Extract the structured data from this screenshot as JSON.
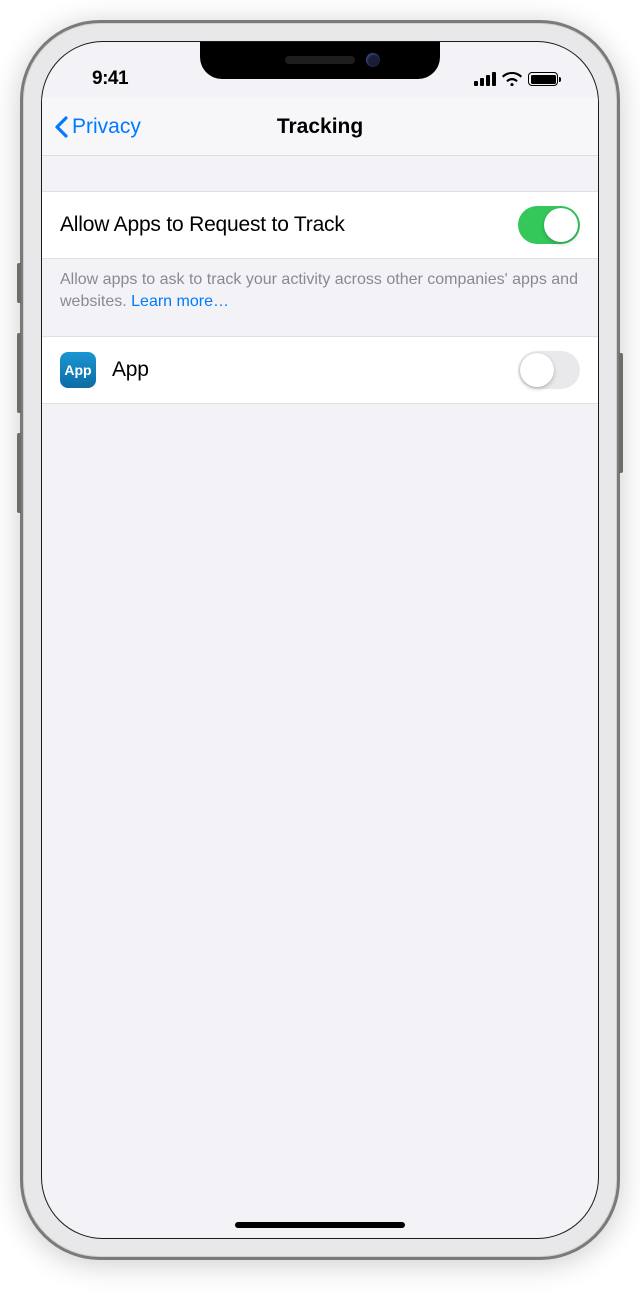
{
  "status_bar": {
    "time": "9:41"
  },
  "nav": {
    "back_label": "Privacy",
    "title": "Tracking"
  },
  "master_toggle": {
    "label": "Allow Apps to Request to Track",
    "on": true
  },
  "footer": {
    "text": "Allow apps to ask to track your activity across other companies' apps and websites. ",
    "learn_more": "Learn more…"
  },
  "apps": [
    {
      "name": "App",
      "icon_label": "App",
      "on": false
    }
  ]
}
